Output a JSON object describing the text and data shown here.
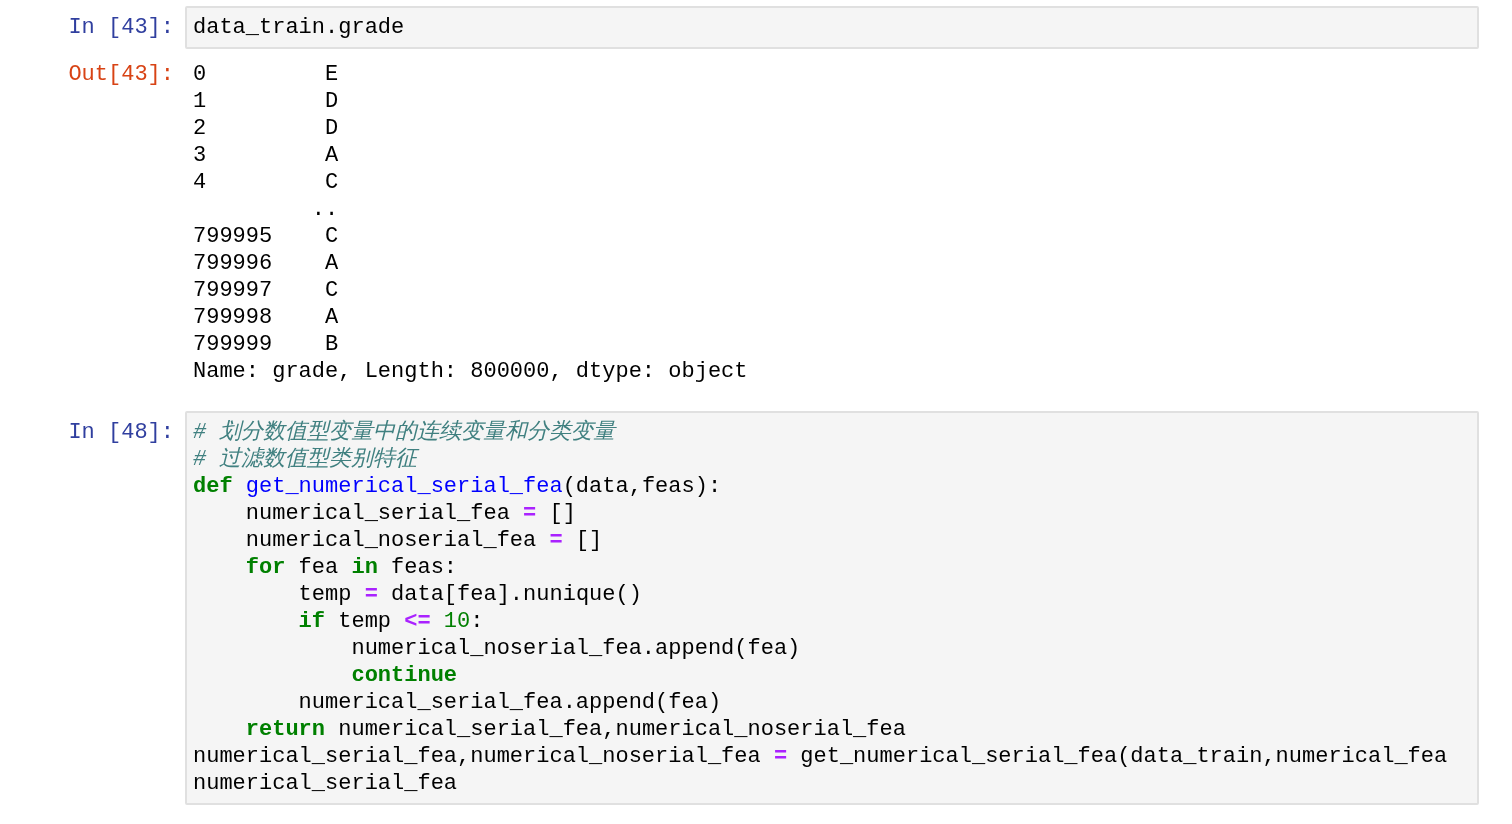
{
  "cells": [
    {
      "kind": "input",
      "prompt": "In [43]:",
      "lines": [
        [
          {
            "kind": "text",
            "text": "data_train.grade"
          }
        ]
      ]
    },
    {
      "kind": "output",
      "prompt": "Out[43]:",
      "lines": [
        "0         E",
        "1         D",
        "2         D",
        "3         A",
        "4         C",
        "         ..",
        "799995    C",
        "799996    A",
        "799997    C",
        "799998    A",
        "799999    B",
        "Name: grade, Length: 800000, dtype: object"
      ]
    },
    {
      "kind": "input",
      "prompt": "In [48]:",
      "lines": [
        [
          {
            "kind": "comment",
            "text": "# 划分数值型变量中的连续变量和分类变量"
          }
        ],
        [
          {
            "kind": "comment",
            "text": "# 过滤数值型类别特征"
          }
        ],
        [
          {
            "kind": "keyword",
            "text": "def"
          },
          {
            "kind": "function",
            "text": " get_numerical_serial_fea"
          },
          {
            "kind": "text",
            "text": "(data,feas):"
          }
        ],
        [
          {
            "kind": "text",
            "text": "    numerical_serial_fea "
          },
          {
            "kind": "operator",
            "text": "="
          },
          {
            "kind": "text",
            "text": " []"
          }
        ],
        [
          {
            "kind": "text",
            "text": "    numerical_noserial_fea "
          },
          {
            "kind": "operator",
            "text": "="
          },
          {
            "kind": "text",
            "text": " []"
          }
        ],
        [
          {
            "kind": "keyword",
            "text": "    for"
          },
          {
            "kind": "text",
            "text": " fea "
          },
          {
            "kind": "keyword",
            "text": "in"
          },
          {
            "kind": "text",
            "text": " feas:"
          }
        ],
        [
          {
            "kind": "text",
            "text": "        temp "
          },
          {
            "kind": "operator",
            "text": "="
          },
          {
            "kind": "text",
            "text": " data[fea].nunique()"
          }
        ],
        [
          {
            "kind": "keyword",
            "text": "        if"
          },
          {
            "kind": "text",
            "text": " temp "
          },
          {
            "kind": "operator",
            "text": "<="
          },
          {
            "kind": "number",
            "text": " 10"
          },
          {
            "kind": "text",
            "text": ":"
          }
        ],
        [
          {
            "kind": "text",
            "text": "            numerical_noserial_fea.append(fea)"
          }
        ],
        [
          {
            "kind": "keyword",
            "text": "            continue"
          }
        ],
        [
          {
            "kind": "text",
            "text": "        numerical_serial_fea.append(fea)"
          }
        ],
        [
          {
            "kind": "keyword",
            "text": "    return"
          },
          {
            "kind": "text",
            "text": " numerical_serial_fea,numerical_noserial_fea"
          }
        ],
        [
          {
            "kind": "text",
            "text": "numerical_serial_fea,numerical_noserial_fea "
          },
          {
            "kind": "operator",
            "text": "="
          },
          {
            "kind": "text",
            "text": " get_numerical_serial_fea(data_train,numerical_fea"
          }
        ],
        [
          {
            "kind": "text",
            "text": "numerical_serial_fea"
          }
        ]
      ]
    }
  ]
}
